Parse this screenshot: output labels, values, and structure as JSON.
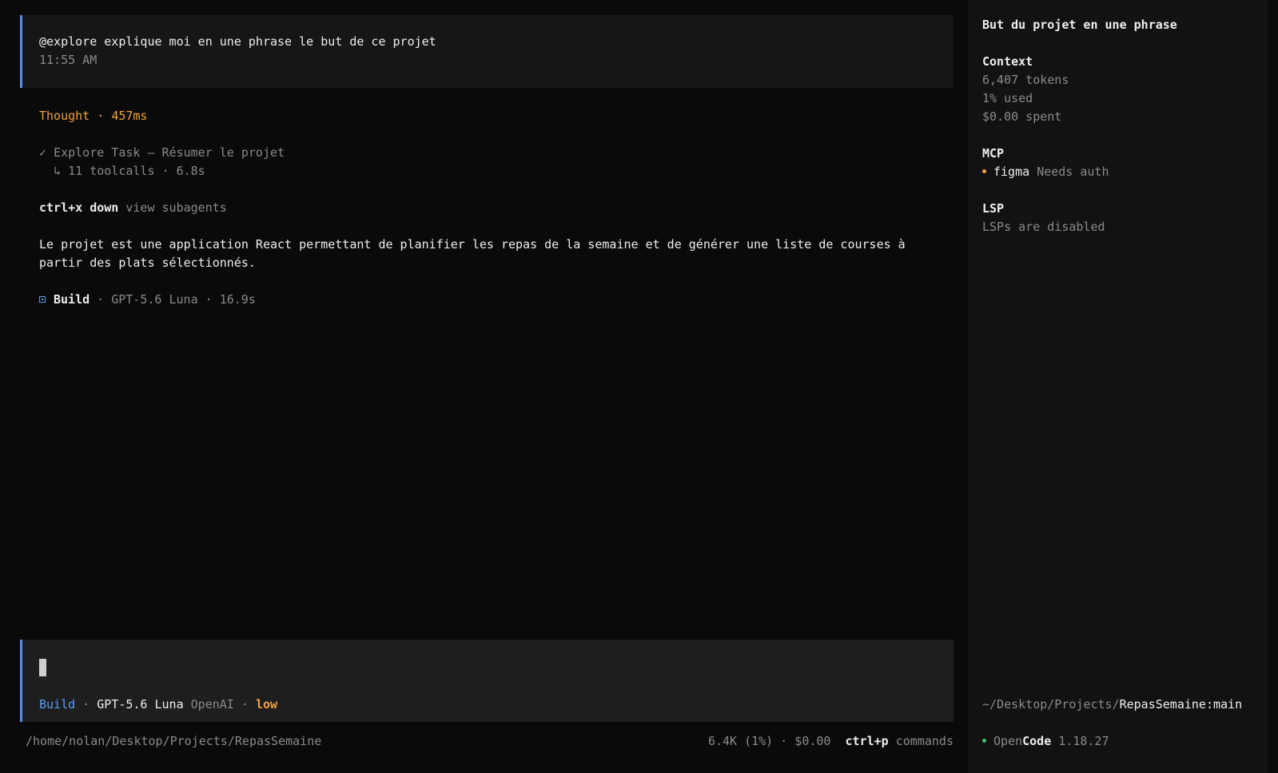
{
  "conversation": {
    "user_message": {
      "text": "@explore explique moi en une phrase le but de ce projet",
      "time": "11:55 AM"
    },
    "thought": {
      "label": "Thought",
      "sep": " · ",
      "duration": "457ms"
    },
    "task": {
      "check": "✓",
      "text": "Explore Task — Résumer le projet",
      "sub_arrow": "↳",
      "sub_text": "11 toolcalls · 6.8s"
    },
    "subagents_hint": {
      "key": "ctrl+x down",
      "label": "view subagents"
    },
    "answer": {
      "line1": "Le projet est une application React permettant de planifier les repas de la semaine et de générer une liste de courses à",
      "line2": "partir des plats sélectionnés."
    },
    "build_line": {
      "mode": "Build",
      "sep": " · ",
      "model": "GPT-5.6 Luna",
      "duration": "16.9s"
    }
  },
  "prompt": {
    "mode": "Build",
    "sep1": " · ",
    "model": "GPT-5.6 Luna",
    "provider": "OpenAI",
    "sep2": " · ",
    "effort": "low"
  },
  "status_bar": {
    "path": "/home/nolan/Desktop/Projects/RepasSemaine",
    "usage": "6.4K (1%) · $0.00",
    "commands_key": "ctrl+p",
    "commands_label": "commands"
  },
  "sidebar": {
    "title": "But du projet en une phrase",
    "context": {
      "heading": "Context",
      "tokens": "6,407 tokens",
      "used": "1% used",
      "spent": "$0.00 spent"
    },
    "mcp": {
      "heading": "MCP",
      "server_name": "figma",
      "server_status": "Needs auth",
      "status_color": "#f0a040"
    },
    "lsp": {
      "heading": "LSP",
      "status": "LSPs are disabled"
    },
    "cwd": {
      "prefix": "~/Desktop/Projects/",
      "project": "RepasSemaine",
      "branch": ":main"
    },
    "app": {
      "name_part1": "Open",
      "name_part2": "Code",
      "version": "1.18.27"
    }
  },
  "colors": {
    "accent_blue": "#5b8def",
    "orange": "#f0a040",
    "green": "#3fbf6f"
  }
}
